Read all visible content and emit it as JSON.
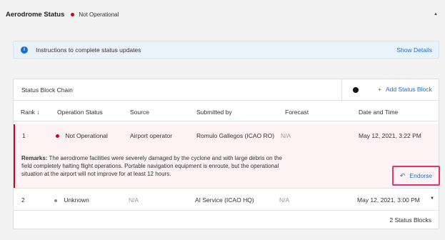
{
  "header": {
    "title": "Aerodrome Status",
    "status": "Not Operational",
    "collapse_icon": "caret-up-icon"
  },
  "info": {
    "text": "Instructions to complete status updates",
    "action": "Show Details",
    "icon": "info-icon"
  },
  "chain": {
    "title": "Status Block Chain",
    "add_label": "Add Status Block",
    "add_icon": "plus-icon"
  },
  "columns": [
    "Rank ↓",
    "Operation Status",
    "Source",
    "Submitted by",
    "Forecast",
    "Date and Time"
  ],
  "rows": [
    {
      "rank": "1",
      "status": "Not Operational",
      "source": "Airport operator",
      "submitted_by": "Romulo Gallegos (ICAO RO)",
      "forecast": "N/A",
      "datetime": "May 12, 2021, 3:22 PM",
      "remarks_label": "Remarks:",
      "remarks_line1": " The aerodrome facilities were severely damaged by the cyclone and with large debris on the",
      "remarks_line2": "field completely halting flight operations. Portable navigation equipment is enroute, but the operational",
      "remarks_line3": "situation at the airport will not improve for at least 12 hours.",
      "endorse_label": "Endorse"
    },
    {
      "rank": "2",
      "status": "Unknown",
      "source": "N/A",
      "submitted_by": "AI Service (ICAO HQ)",
      "forecast": "N/A",
      "datetime": "May 12, 2021, 3:00 PM",
      "expand_icon": "caret-down-icon"
    }
  ],
  "footer": {
    "count": "2 Status Blocks"
  },
  "colors": {
    "accent": "#1a6fd6",
    "alert": "#d0021b",
    "highlight": "#e8316f"
  }
}
